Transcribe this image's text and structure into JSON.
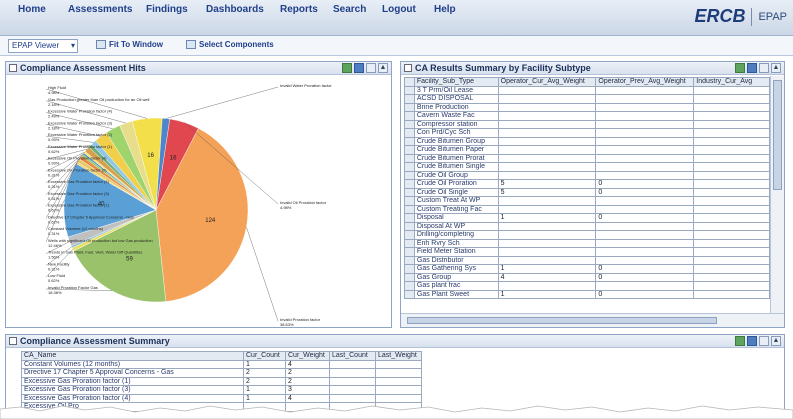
{
  "menu": {
    "items": [
      "Home",
      "Assessments",
      "Findings",
      "Dashboards",
      "Reports",
      "Search",
      "Logout",
      "Help"
    ],
    "logo": "ERCB",
    "app": "EPAP"
  },
  "toolbar": {
    "viewer_select": "EPAP Viewer",
    "fit_label": "Fit To Window",
    "select_label": "Select Components"
  },
  "hits_panel": {
    "title": "Compliance Assessment Hits",
    "slices": [
      {
        "label": "Invalid Oil Proration factor",
        "pct": "4.98%",
        "value": 16,
        "color": "#e1474f"
      },
      {
        "label": "Invalid Proration factor",
        "pct": "38.63%",
        "value": 124,
        "color": "#f4a257"
      },
      {
        "label": "Invalid Proration Factor Gas",
        "pct": "18.38%",
        "value": 59,
        "color": "#9ac26a"
      },
      {
        "label": "Low Fluid",
        "pct": "0.62%",
        "value": 2,
        "color": "#e8e06a"
      },
      {
        "label": "New Facility",
        "pct": "0.31%",
        "value": 1,
        "color": "#7db7d8"
      },
      {
        "label": "Trends in Gas Plant, Fuel, Vent, Water Diff Quantities",
        "pct": "1.56%",
        "value": 5,
        "color": "#c0c0c0"
      },
      {
        "label": "Wells with significant Oil production but low Gas production",
        "pct": "12.46%",
        "value": 40,
        "color": "#5aa0d6"
      },
      {
        "label": "Constant Volumes (12 months)",
        "pct": "0.31%",
        "value": 1,
        "color": "#f2d35a"
      },
      {
        "label": "Directive 17 Chapter 5 Approval Concerns - Gas",
        "pct": "0.62%",
        "value": 2,
        "color": "#e8c76a"
      },
      {
        "label": "Excessive Gas Proration factor (1)",
        "pct": "0.62%",
        "value": 2,
        "color": "#e58b44"
      },
      {
        "label": "Excessive Gas Proration factor (3)",
        "pct": "0.31%",
        "value": 1,
        "color": "#8bc34a"
      },
      {
        "label": "Excessive Gas Proration factor (4)",
        "pct": "0.31%",
        "value": 1,
        "color": "#4a90c2"
      },
      {
        "label": "Excessive Oil Proration factor (2)",
        "pct": "0.31%",
        "value": 1,
        "color": "#f7e36f"
      },
      {
        "label": "Excessive Oil Proration factor (4)",
        "pct": "0.93%",
        "value": 3,
        "color": "#d8a04e"
      },
      {
        "label": "Excessive Water Proration factor (1)",
        "pct": "0.62%",
        "value": 2,
        "color": "#6fb07a"
      },
      {
        "label": "Excessive Water Proration factor (2)",
        "pct": "0.93%",
        "value": 3,
        "color": "#8ec8e8"
      },
      {
        "label": "Excessive Water Proration factor (3)",
        "pct": "2.18%",
        "value": 7,
        "color": "#f1cf4b"
      },
      {
        "label": "Excessive Water Proration factor (4)",
        "pct": "2.49%",
        "value": 8,
        "color": "#9fd36b"
      },
      {
        "label": "Gas Production greater than Oil production for an Oil well",
        "pct": "2.18%",
        "value": 7,
        "color": "#e7dd8a"
      },
      {
        "label": "High Fluid",
        "pct": "4.98%",
        "value": 16,
        "color": "#f3df4a"
      },
      {
        "label": "Invalid Water Proration factor",
        "pct": "",
        "value": 4,
        "color": "#4e86c9"
      }
    ]
  },
  "results_panel": {
    "title": "CA Results Summary by Facility Subtype",
    "columns": [
      "Facility_Sub_Type",
      "Operator_Cur_Avg_Weight",
      "Operator_Prev_Avg_Weight",
      "Industry_Cur_Avg"
    ],
    "rows": [
      [
        "3 T Prm/Oil Lease",
        "",
        "",
        ""
      ],
      [
        "ACSD DISPOSAL",
        "",
        "",
        ""
      ],
      [
        "Brine Production",
        "",
        "",
        ""
      ],
      [
        "Cavern Waste Fac",
        "",
        "",
        ""
      ],
      [
        "Compressor station",
        "",
        "",
        ""
      ],
      [
        "Con Prd/Cyc Sch",
        "",
        "",
        ""
      ],
      [
        "Crude Bitumen Group",
        "",
        "",
        ""
      ],
      [
        "Crude Bitumen Paper",
        "",
        "",
        ""
      ],
      [
        "Crude Bitumen Prorat",
        "",
        "",
        ""
      ],
      [
        "Crude Bitumen Single",
        "",
        "",
        ""
      ],
      [
        "Crude Oil Group",
        "",
        "",
        ""
      ],
      [
        "Crude Oil Proration",
        "5",
        "0",
        ""
      ],
      [
        "Crude Oil Single",
        "5",
        "0",
        ""
      ],
      [
        "Custom Treat At WP",
        "",
        "",
        ""
      ],
      [
        "Custom Treating Fac",
        "",
        "",
        ""
      ],
      [
        "Disposal",
        "1",
        "0",
        ""
      ],
      [
        "Disposal At WP",
        "",
        "",
        ""
      ],
      [
        "Drilling/completing",
        "",
        "",
        ""
      ],
      [
        "Enh Rvry Sch",
        "",
        "",
        ""
      ],
      [
        "Field Meter Station",
        "",
        "",
        ""
      ],
      [
        "Gas Distributor",
        "",
        "",
        ""
      ],
      [
        "Gas Gathering Sys",
        "1",
        "0",
        ""
      ],
      [
        "Gas Group",
        "4",
        "0",
        ""
      ],
      [
        "Gas plant frac",
        "",
        "",
        ""
      ],
      [
        "Gas Plant Sweet",
        "1",
        "0",
        ""
      ]
    ]
  },
  "summary_panel": {
    "title": "Compliance Assessment Summary",
    "columns": [
      "CA_Name",
      "Cur_Count",
      "Cur_Weight",
      "Last_Count",
      "Last_Weight"
    ],
    "rows": [
      [
        "Constant Volumes (12 months)",
        "1",
        "4",
        "",
        ""
      ],
      [
        "Directive 17 Chapter 5 Approval Concerns - Gas",
        "2",
        "2",
        "",
        ""
      ],
      [
        "Excessive Gas Proration factor (1)",
        "2",
        "2",
        "",
        ""
      ],
      [
        "Excessive Gas Proration factor (3)",
        "1",
        "3",
        "",
        ""
      ],
      [
        "Excessive Gas Proration factor (4)",
        "1",
        "4",
        "",
        ""
      ],
      [
        "Excessive Oil Pro",
        "",
        "",
        "",
        ""
      ]
    ]
  }
}
